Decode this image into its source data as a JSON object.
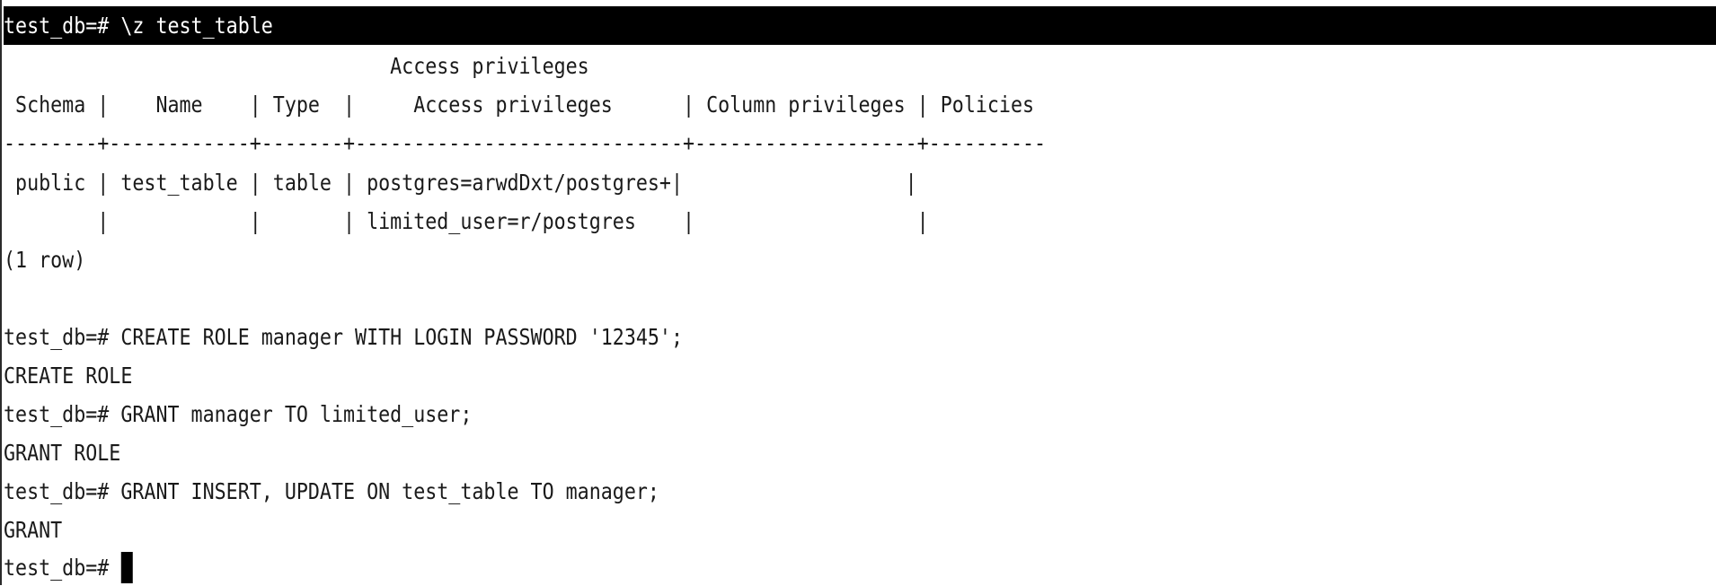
{
  "terminal": {
    "lines": [
      "test_db=# \\z test_table",
      "                                 Access privileges",
      " Schema |    Name    | Type  |     Access privileges      | Column privileges | Policies",
      "--------+------------+-------+----------------------------+-------------------+----------",
      " public | test_table | table | postgres=arwdDxt/postgres+|                   |",
      "        |            |       | limited_user=r/postgres    |                   |",
      "(1 row)",
      "",
      "test_db=# CREATE ROLE manager WITH LOGIN PASSWORD '12345';",
      "CREATE ROLE",
      "test_db=# GRANT manager TO limited_user;",
      "GRANT ROLE",
      "test_db=# GRANT INSERT, UPDATE ON test_table TO manager;",
      "GRANT",
      "test_db=# "
    ]
  },
  "colors": {
    "background": "#ffffff",
    "text": "#1a1a1a",
    "header_bar": "#000000",
    "header_text": "#ffffff",
    "cursor": "#000000"
  }
}
